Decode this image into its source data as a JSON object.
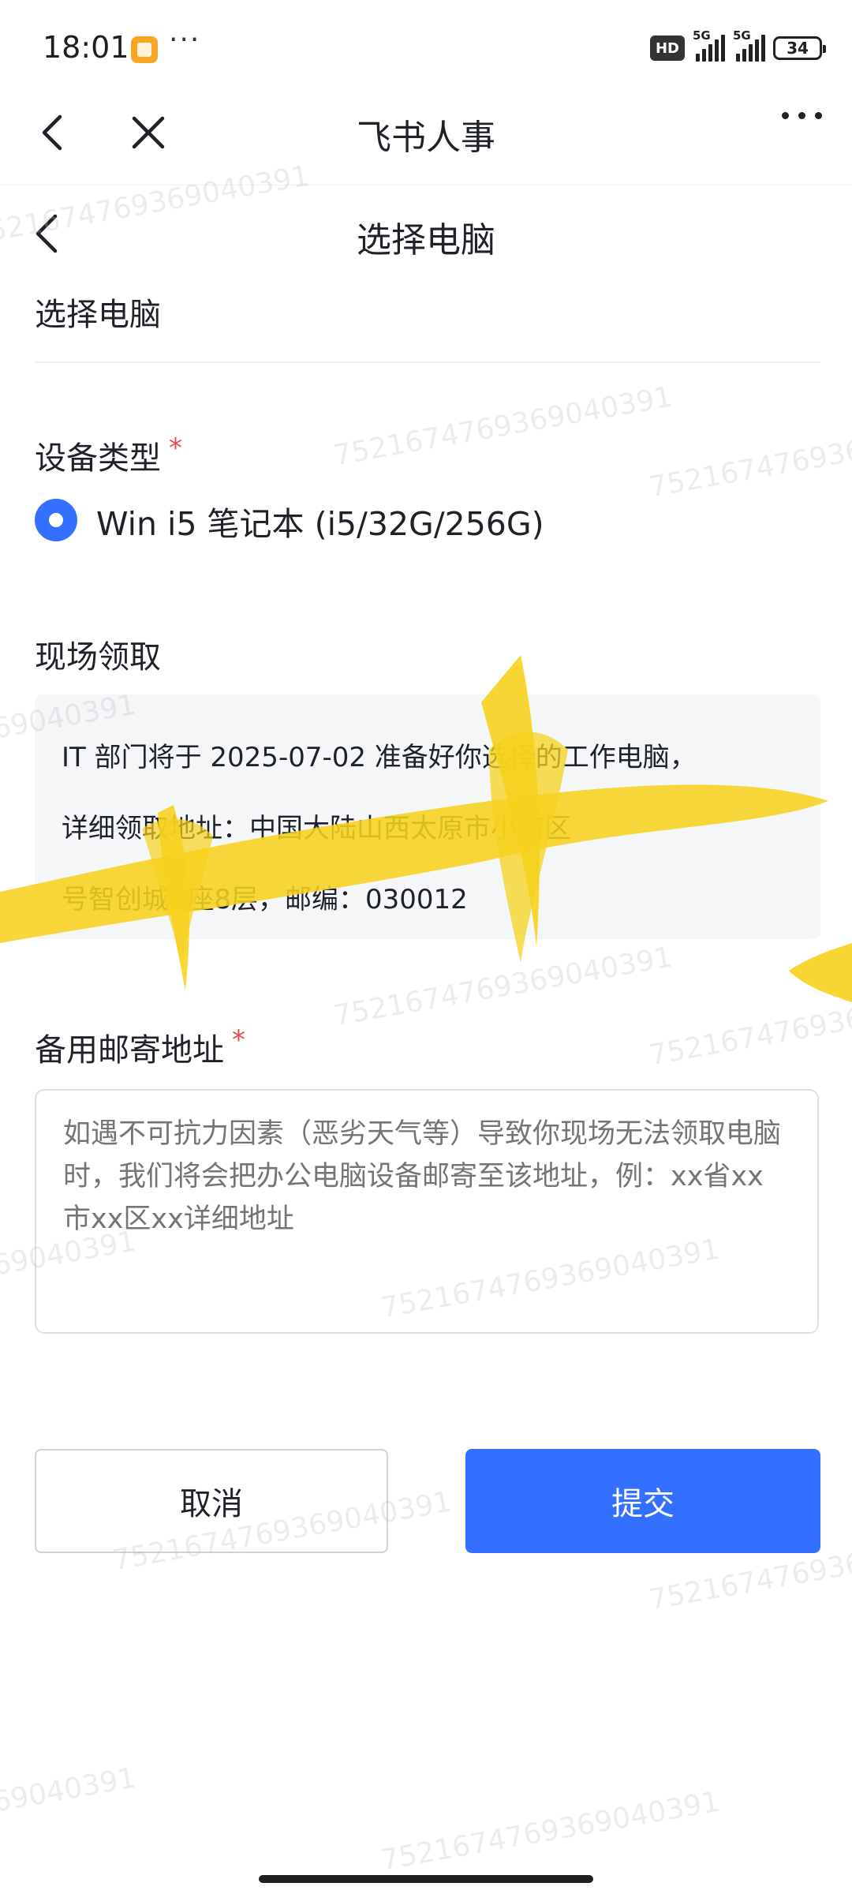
{
  "status_bar": {
    "time": "18:01",
    "more": "···",
    "hd": "HD",
    "signal1": "5G",
    "signal2": "5G",
    "battery": "34"
  },
  "nav": {
    "title": "飞书人事"
  },
  "page": {
    "title": "选择电脑",
    "section_heading": "选择电脑"
  },
  "device": {
    "label": "设备类型",
    "required_mark": "*",
    "option": "Win i5 笔记本 (i5/32G/256G)",
    "selected": true
  },
  "pickup": {
    "label": "现场领取",
    "line1": "IT 部门将于 2025-07-02 准备好你选择的工作电脑，",
    "line2": "详细领取地址：中国大陆山西太原市小店区",
    "line3": "号智创城B座8层，邮编：030012"
  },
  "backup_address": {
    "label": "备用邮寄地址",
    "required_mark": "*",
    "placeholder": "如遇不可抗力因素（恶劣天气等）导致你现场无法领取电脑时，我们将会把办公电脑设备邮寄至该地址，例：xx省xx市xx区xx详细地址",
    "value": ""
  },
  "actions": {
    "cancel": "取消",
    "submit": "提交"
  },
  "watermark": "7521674769369040391",
  "colors": {
    "accent": "#3370ff",
    "required": "#e34d4d",
    "scribble": "#f6d21e"
  }
}
